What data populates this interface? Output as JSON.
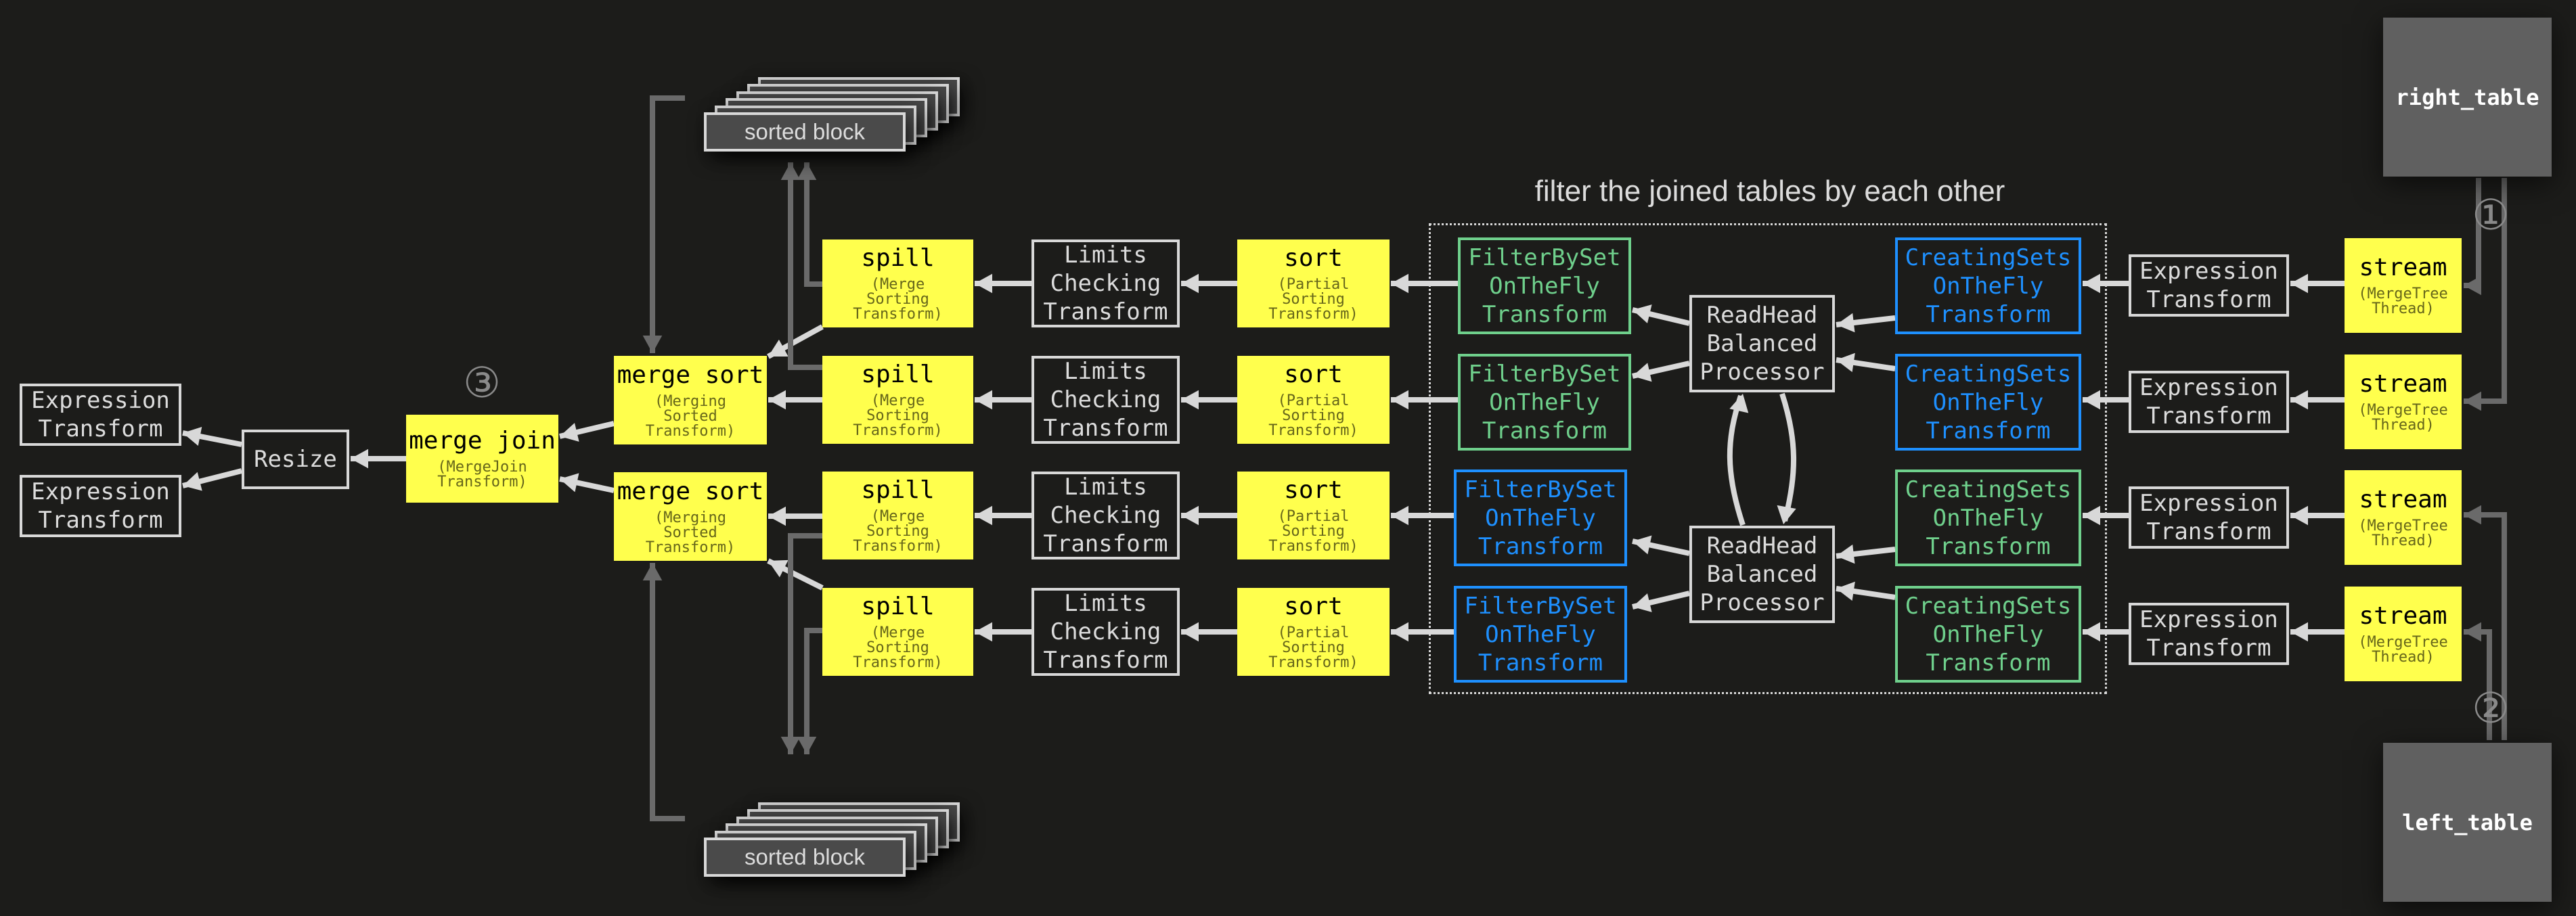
{
  "title": "filter the joined tables by each other",
  "colors": {
    "background": "#1c1c1a",
    "processor_highlight": "#ffff4d",
    "filter_green": "#6fd08c",
    "filter_blue": "#1e90ff",
    "edge": "#d8d8d8",
    "spill_edge": "#6a6a6a",
    "table": "#606060"
  },
  "tables": {
    "right": "right_table",
    "left": "left_table"
  },
  "steps": {
    "one": "①",
    "two": "②",
    "three": "③"
  },
  "sorted_block_label": "sorted block",
  "output_expressions": [
    {
      "lines": "Expression\nTransform"
    },
    {
      "lines": "Expression\nTransform"
    }
  ],
  "resize": {
    "label": "Resize"
  },
  "merge_join": {
    "title": "merge join",
    "sub": "(MergeJoin\nTransform)"
  },
  "merge_sorts": [
    {
      "title": "merge sort",
      "sub": "(Merging\nSorted\nTransform)"
    },
    {
      "title": "merge sort",
      "sub": "(Merging\nSorted\nTransform)"
    }
  ],
  "rows": [
    {
      "spill": {
        "title": "spill",
        "sub": "(Merge\nSorting\nTransform)"
      },
      "limits": "Limits\nChecking\nTransform",
      "sort": {
        "title": "sort",
        "sub": "(Partial\nSorting\nTransform)"
      },
      "filter": {
        "lines": "FilterBySet\nOnTheFly\nTransform",
        "color": "green"
      },
      "creating": {
        "lines": "CreatingSets\nOnTheFly\nTransform",
        "color": "blue"
      },
      "expression": "Expression\nTransform",
      "stream": {
        "title": "stream",
        "sub": "(MergeTree\nThread)"
      }
    },
    {
      "spill": {
        "title": "spill",
        "sub": "(Merge\nSorting\nTransform)"
      },
      "limits": "Limits\nChecking\nTransform",
      "sort": {
        "title": "sort",
        "sub": "(Partial\nSorting\nTransform)"
      },
      "filter": {
        "lines": "FilterBySet\nOnTheFly\nTransform",
        "color": "green"
      },
      "creating": {
        "lines": "CreatingSets\nOnTheFly\nTransform",
        "color": "blue"
      },
      "expression": "Expression\nTransform",
      "stream": {
        "title": "stream",
        "sub": "(MergeTree\nThread)"
      }
    },
    {
      "spill": {
        "title": "spill",
        "sub": "(Merge\nSorting\nTransform)"
      },
      "limits": "Limits\nChecking\nTransform",
      "sort": {
        "title": "sort",
        "sub": "(Partial\nSorting\nTransform)"
      },
      "filter": {
        "lines": "FilterBySet\nOnTheFly\nTransform",
        "color": "blue"
      },
      "creating": {
        "lines": "CreatingSets\nOnTheFly\nTransform",
        "color": "green"
      },
      "expression": "Expression\nTransform",
      "stream": {
        "title": "stream",
        "sub": "(MergeTree\nThread)"
      }
    },
    {
      "spill": {
        "title": "spill",
        "sub": "(Merge\nSorting\nTransform)"
      },
      "limits": "Limits\nChecking\nTransform",
      "sort": {
        "title": "sort",
        "sub": "(Partial\nSorting\nTransform)"
      },
      "filter": {
        "lines": "FilterBySet\nOnTheFly\nTransform",
        "color": "blue"
      },
      "creating": {
        "lines": "CreatingSets\nOnTheFly\nTransform",
        "color": "green"
      },
      "expression": "Expression\nTransform",
      "stream": {
        "title": "stream",
        "sub": "(MergeTree\nThread)"
      }
    }
  ],
  "readhead": [
    {
      "lines": "ReadHead\nBalanced\nProcessor"
    },
    {
      "lines": "ReadHead\nBalanced\nProcessor"
    }
  ]
}
